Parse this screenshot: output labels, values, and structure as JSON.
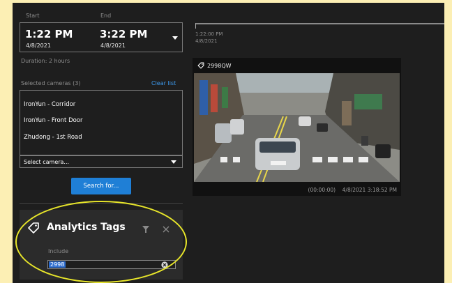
{
  "time_range": {
    "start_label": "Start",
    "end_label": "End",
    "start_time": "1:22 PM",
    "start_date": "4/8/2021",
    "end_time": "3:22 PM",
    "end_date": "4/8/2021",
    "duration": "Duration: 2 hours"
  },
  "cameras": {
    "header": "Selected cameras (3)",
    "clear_label": "Clear list",
    "items": [
      "IronYun - Corridor",
      "IronYun - Front Door",
      "Zhudong - 1st Road"
    ],
    "select_placeholder": "Select camera..."
  },
  "search_button": "Search for...",
  "analytics_tags": {
    "title": "Analytics Tags",
    "include_label": "Include",
    "value": "2998"
  },
  "timeline": {
    "time": "1:22:00 PM",
    "date": "4/8/2021"
  },
  "result": {
    "tag": "2998QW",
    "offset": "(00:00:00)",
    "timestamp": "4/8/2021 3:18:52 PM"
  },
  "colors": {
    "accent": "#1f7fd6",
    "highlight": "#e8e62a",
    "background": "#1e1e1e"
  }
}
